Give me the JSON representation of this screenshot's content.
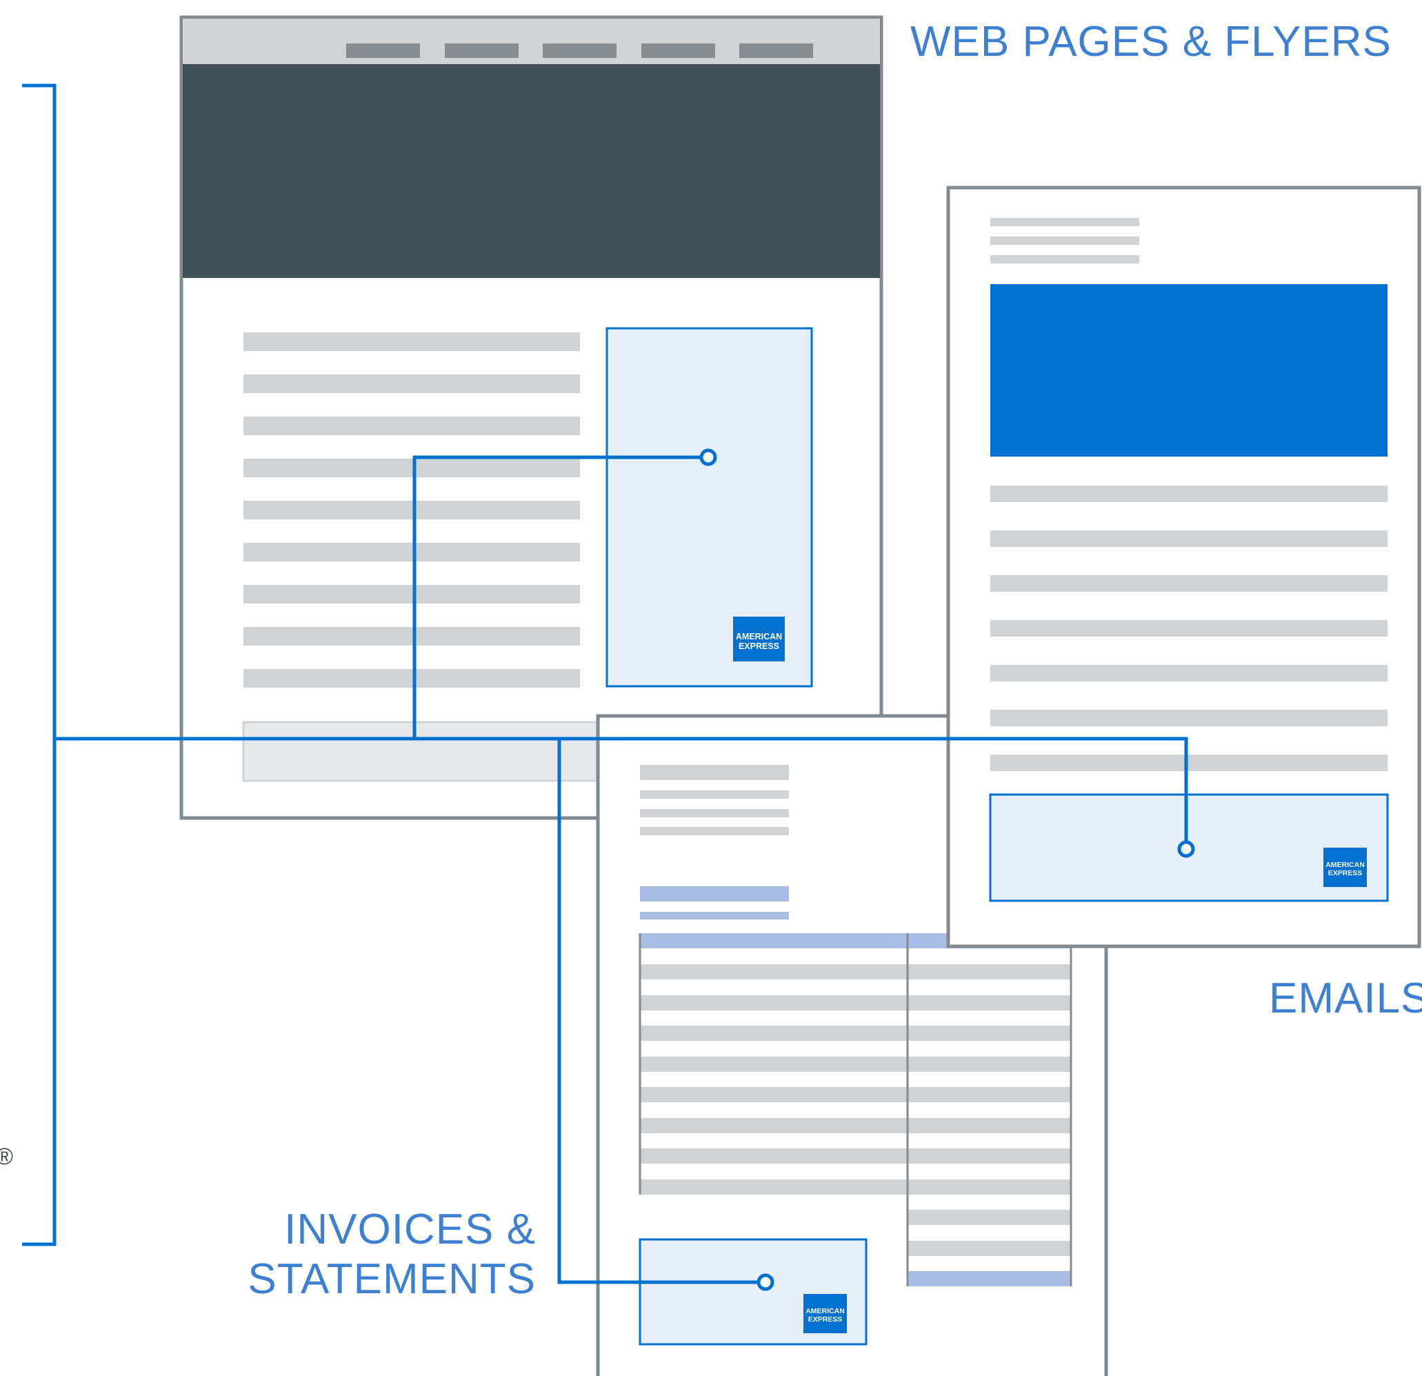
{
  "labels": {
    "web": "WEB PAGES & FLYERS",
    "emails": "EMAILS",
    "invoices_line1": "INVOICES &",
    "invoices_line2": "STATEMENTS",
    "registered": "®"
  },
  "logo": {
    "line1": "AMERICAN",
    "line2": "EXPRESS"
  },
  "colors": {
    "accent": "#0170ce",
    "label": "#3d7fd1",
    "frame": "#828a8f",
    "placeholder": "#cfd3d6",
    "dark_banner": "#3f5156",
    "panel": "#e6eef8",
    "table_header": "#a7bde3"
  }
}
